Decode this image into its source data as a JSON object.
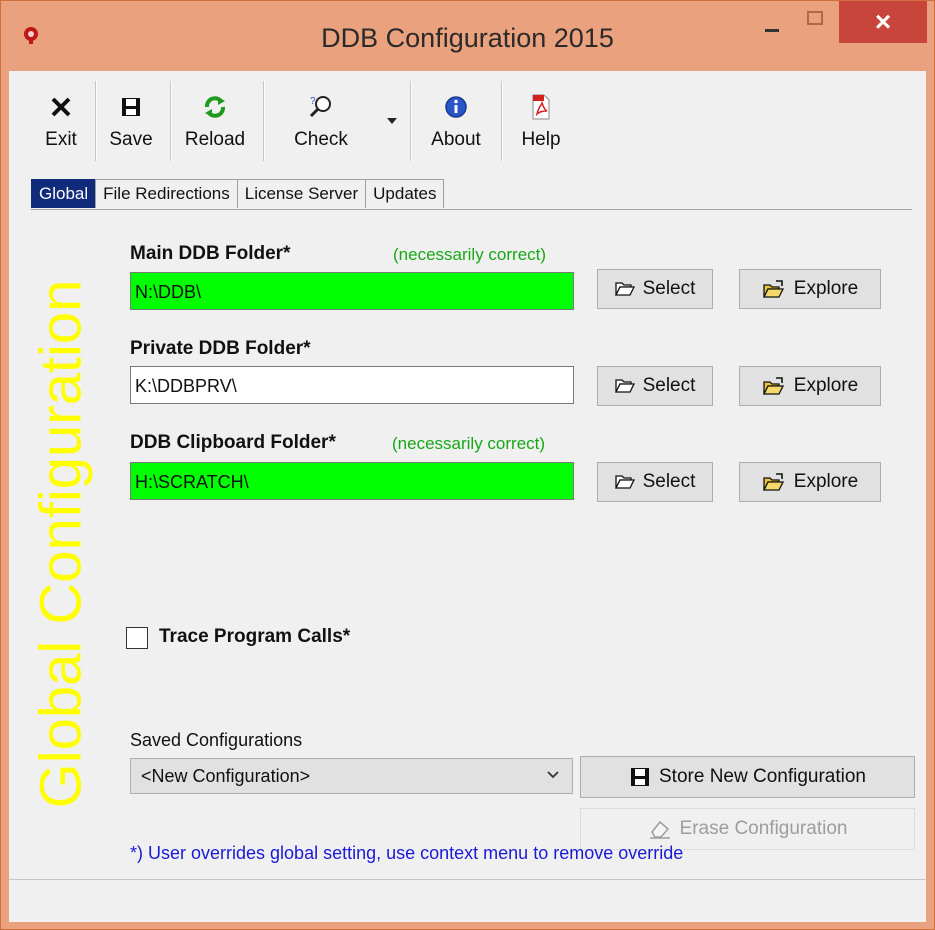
{
  "window": {
    "title": "DDB Configuration 2015",
    "close_glyph": "×"
  },
  "toolbar": {
    "exit_label": "Exit",
    "save_label": "Save",
    "reload_label": "Reload",
    "check_label": "Check",
    "about_label": "About",
    "help_label": "Help"
  },
  "tabs": [
    {
      "label": "Global",
      "active": true
    },
    {
      "label": "File Redirections",
      "active": false
    },
    {
      "label": "License Server",
      "active": false
    },
    {
      "label": "Updates",
      "active": false
    }
  ],
  "panel": {
    "vertical_title": "Global Configuration",
    "main_folder": {
      "label": "Main DDB Folder*",
      "note": "(necessarily correct)",
      "value": "N:\\DDB\\"
    },
    "private_folder": {
      "label": "Private DDB Folder*",
      "value": "K:\\DDBPRV\\"
    },
    "clipboard_folder": {
      "label": "DDB Clipboard Folder*",
      "note": "(necessarily correct)",
      "value": "H:\\SCRATCH\\"
    },
    "select_label": "Select",
    "explore_label": "Explore",
    "trace_label": "Trace Program Calls*",
    "trace_checked": false,
    "saved_configs_label": "Saved Configurations",
    "saved_config_value": "<New Configuration>",
    "store_label": "Store New Configuration",
    "erase_label": "Erase Configuration",
    "footnote": "*) User overrides global setting, use context menu to remove override"
  },
  "colors": {
    "titlebar": "#eaa17e",
    "close": "#c7453b",
    "active_tab": "#102a7c",
    "highlight_field": "#00ff00",
    "vertical_title": "#ffff00",
    "note": "#17a817",
    "footnote": "#1a1ad8"
  }
}
